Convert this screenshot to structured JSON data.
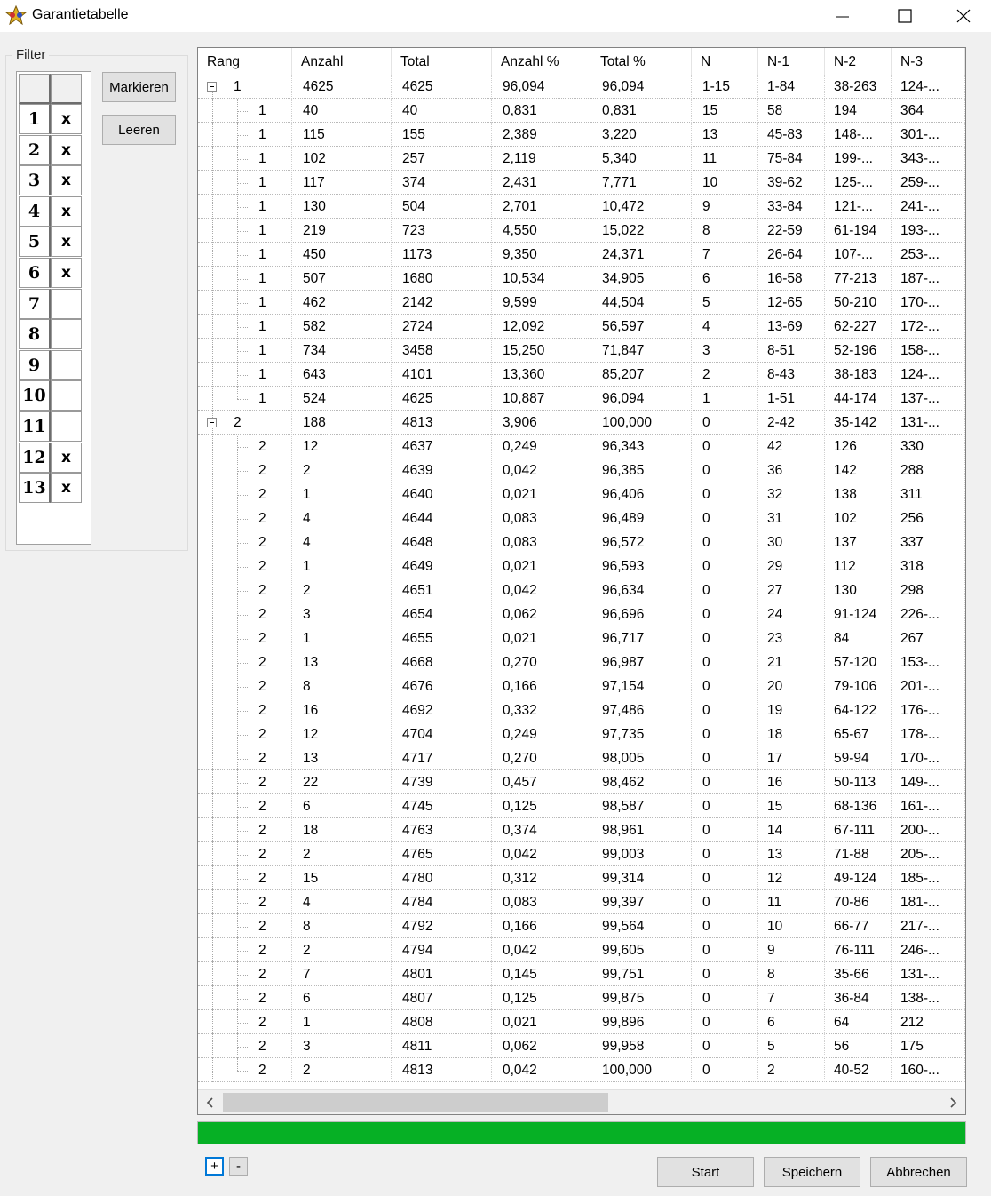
{
  "window": {
    "title": "Garantietabelle",
    "icon": "lotto-star-icon"
  },
  "filter": {
    "legend": "Filter",
    "rows": [
      {
        "num": "1",
        "mark": "x"
      },
      {
        "num": "2",
        "mark": "x"
      },
      {
        "num": "3",
        "mark": "x"
      },
      {
        "num": "4",
        "mark": "x"
      },
      {
        "num": "5",
        "mark": "x"
      },
      {
        "num": "6",
        "mark": "x"
      },
      {
        "num": "7",
        "mark": ""
      },
      {
        "num": "8",
        "mark": ""
      },
      {
        "num": "9",
        "mark": ""
      },
      {
        "num": "10",
        "mark": ""
      },
      {
        "num": "11",
        "mark": ""
      },
      {
        "num": "12",
        "mark": "x"
      },
      {
        "num": "13",
        "mark": "x"
      }
    ],
    "mark_button": "Markieren",
    "clear_button": "Leeren"
  },
  "table": {
    "columns": [
      "Rang",
      "Anzahl",
      "Total",
      "Anzahl %",
      "Total %",
      "N",
      "N-1",
      "N-2",
      "N-3"
    ],
    "rows": [
      {
        "level": 0,
        "rang": "1",
        "cells": [
          "4625",
          "4625",
          "96,094",
          "96,094",
          "1-15",
          "1-84",
          "38-263",
          "124-..."
        ]
      },
      {
        "level": 1,
        "rang": "1",
        "cells": [
          "40",
          "40",
          "0,831",
          "0,831",
          "15",
          "58",
          "194",
          "364"
        ]
      },
      {
        "level": 1,
        "rang": "1",
        "cells": [
          "115",
          "155",
          "2,389",
          "3,220",
          "13",
          "45-83",
          "148-...",
          "301-..."
        ]
      },
      {
        "level": 1,
        "rang": "1",
        "cells": [
          "102",
          "257",
          "2,119",
          "5,340",
          "11",
          "75-84",
          "199-...",
          "343-..."
        ]
      },
      {
        "level": 1,
        "rang": "1",
        "cells": [
          "117",
          "374",
          "2,431",
          "7,771",
          "10",
          "39-62",
          "125-...",
          "259-..."
        ]
      },
      {
        "level": 1,
        "rang": "1",
        "cells": [
          "130",
          "504",
          "2,701",
          "10,472",
          "9",
          "33-84",
          "121-...",
          "241-..."
        ]
      },
      {
        "level": 1,
        "rang": "1",
        "cells": [
          "219",
          "723",
          "4,550",
          "15,022",
          "8",
          "22-59",
          "61-194",
          "193-..."
        ]
      },
      {
        "level": 1,
        "rang": "1",
        "cells": [
          "450",
          "1173",
          "9,350",
          "24,371",
          "7",
          "26-64",
          "107-...",
          "253-..."
        ]
      },
      {
        "level": 1,
        "rang": "1",
        "cells": [
          "507",
          "1680",
          "10,534",
          "34,905",
          "6",
          "16-58",
          "77-213",
          "187-..."
        ]
      },
      {
        "level": 1,
        "rang": "1",
        "cells": [
          "462",
          "2142",
          "9,599",
          "44,504",
          "5",
          "12-65",
          "50-210",
          "170-..."
        ]
      },
      {
        "level": 1,
        "rang": "1",
        "cells": [
          "582",
          "2724",
          "12,092",
          "56,597",
          "4",
          "13-69",
          "62-227",
          "172-..."
        ]
      },
      {
        "level": 1,
        "rang": "1",
        "cells": [
          "734",
          "3458",
          "15,250",
          "71,847",
          "3",
          "8-51",
          "52-196",
          "158-..."
        ]
      },
      {
        "level": 1,
        "rang": "1",
        "cells": [
          "643",
          "4101",
          "13,360",
          "85,207",
          "2",
          "8-43",
          "38-183",
          "124-..."
        ]
      },
      {
        "level": 1,
        "rang": "1",
        "cells": [
          "524",
          "4625",
          "10,887",
          "96,094",
          "1",
          "1-51",
          "44-174",
          "137-..."
        ]
      },
      {
        "level": 0,
        "rang": "2",
        "cells": [
          "188",
          "4813",
          "3,906",
          "100,000",
          "0",
          "2-42",
          "35-142",
          "131-..."
        ]
      },
      {
        "level": 1,
        "rang": "2",
        "cells": [
          "12",
          "4637",
          "0,249",
          "96,343",
          "0",
          "42",
          "126",
          "330"
        ]
      },
      {
        "level": 1,
        "rang": "2",
        "cells": [
          "2",
          "4639",
          "0,042",
          "96,385",
          "0",
          "36",
          "142",
          "288"
        ]
      },
      {
        "level": 1,
        "rang": "2",
        "cells": [
          "1",
          "4640",
          "0,021",
          "96,406",
          "0",
          "32",
          "138",
          "311"
        ]
      },
      {
        "level": 1,
        "rang": "2",
        "cells": [
          "4",
          "4644",
          "0,083",
          "96,489",
          "0",
          "31",
          "102",
          "256"
        ]
      },
      {
        "level": 1,
        "rang": "2",
        "cells": [
          "4",
          "4648",
          "0,083",
          "96,572",
          "0",
          "30",
          "137",
          "337"
        ]
      },
      {
        "level": 1,
        "rang": "2",
        "cells": [
          "1",
          "4649",
          "0,021",
          "96,593",
          "0",
          "29",
          "112",
          "318"
        ]
      },
      {
        "level": 1,
        "rang": "2",
        "cells": [
          "2",
          "4651",
          "0,042",
          "96,634",
          "0",
          "27",
          "130",
          "298"
        ]
      },
      {
        "level": 1,
        "rang": "2",
        "cells": [
          "3",
          "4654",
          "0,062",
          "96,696",
          "0",
          "24",
          "91-124",
          "226-..."
        ]
      },
      {
        "level": 1,
        "rang": "2",
        "cells": [
          "1",
          "4655",
          "0,021",
          "96,717",
          "0",
          "23",
          "84",
          "267"
        ]
      },
      {
        "level": 1,
        "rang": "2",
        "cells": [
          "13",
          "4668",
          "0,270",
          "96,987",
          "0",
          "21",
          "57-120",
          "153-..."
        ]
      },
      {
        "level": 1,
        "rang": "2",
        "cells": [
          "8",
          "4676",
          "0,166",
          "97,154",
          "0",
          "20",
          "79-106",
          "201-..."
        ]
      },
      {
        "level": 1,
        "rang": "2",
        "cells": [
          "16",
          "4692",
          "0,332",
          "97,486",
          "0",
          "19",
          "64-122",
          "176-..."
        ]
      },
      {
        "level": 1,
        "rang": "2",
        "cells": [
          "12",
          "4704",
          "0,249",
          "97,735",
          "0",
          "18",
          "65-67",
          "178-..."
        ]
      },
      {
        "level": 1,
        "rang": "2",
        "cells": [
          "13",
          "4717",
          "0,270",
          "98,005",
          "0",
          "17",
          "59-94",
          "170-..."
        ]
      },
      {
        "level": 1,
        "rang": "2",
        "cells": [
          "22",
          "4739",
          "0,457",
          "98,462",
          "0",
          "16",
          "50-113",
          "149-..."
        ]
      },
      {
        "level": 1,
        "rang": "2",
        "cells": [
          "6",
          "4745",
          "0,125",
          "98,587",
          "0",
          "15",
          "68-136",
          "161-..."
        ]
      },
      {
        "level": 1,
        "rang": "2",
        "cells": [
          "18",
          "4763",
          "0,374",
          "98,961",
          "0",
          "14",
          "67-111",
          "200-..."
        ]
      },
      {
        "level": 1,
        "rang": "2",
        "cells": [
          "2",
          "4765",
          "0,042",
          "99,003",
          "0",
          "13",
          "71-88",
          "205-..."
        ]
      },
      {
        "level": 1,
        "rang": "2",
        "cells": [
          "15",
          "4780",
          "0,312",
          "99,314",
          "0",
          "12",
          "49-124",
          "185-..."
        ]
      },
      {
        "level": 1,
        "rang": "2",
        "cells": [
          "4",
          "4784",
          "0,083",
          "99,397",
          "0",
          "11",
          "70-86",
          "181-..."
        ]
      },
      {
        "level": 1,
        "rang": "2",
        "cells": [
          "8",
          "4792",
          "0,166",
          "99,564",
          "0",
          "10",
          "66-77",
          "217-..."
        ]
      },
      {
        "level": 1,
        "rang": "2",
        "cells": [
          "2",
          "4794",
          "0,042",
          "99,605",
          "0",
          "9",
          "76-111",
          "246-..."
        ]
      },
      {
        "level": 1,
        "rang": "2",
        "cells": [
          "7",
          "4801",
          "0,145",
          "99,751",
          "0",
          "8",
          "35-66",
          "131-..."
        ]
      },
      {
        "level": 1,
        "rang": "2",
        "cells": [
          "6",
          "4807",
          "0,125",
          "99,875",
          "0",
          "7",
          "36-84",
          "138-..."
        ]
      },
      {
        "level": 1,
        "rang": "2",
        "cells": [
          "1",
          "4808",
          "0,021",
          "99,896",
          "0",
          "6",
          "64",
          "212"
        ]
      },
      {
        "level": 1,
        "rang": "2",
        "cells": [
          "3",
          "4811",
          "0,062",
          "99,958",
          "0",
          "5",
          "56",
          "175"
        ]
      },
      {
        "level": 1,
        "rang": "2",
        "cells": [
          "2",
          "4813",
          "0,042",
          "100,000",
          "0",
          "2",
          "40-52",
          "160-..."
        ]
      }
    ]
  },
  "progress": {
    "fraction": 1.0,
    "color": "#06b025"
  },
  "footer": {
    "expand_label": "+",
    "collapse_label": "-",
    "start_label": "Start",
    "save_label": "Speichern",
    "cancel_label": "Abbrechen"
  }
}
